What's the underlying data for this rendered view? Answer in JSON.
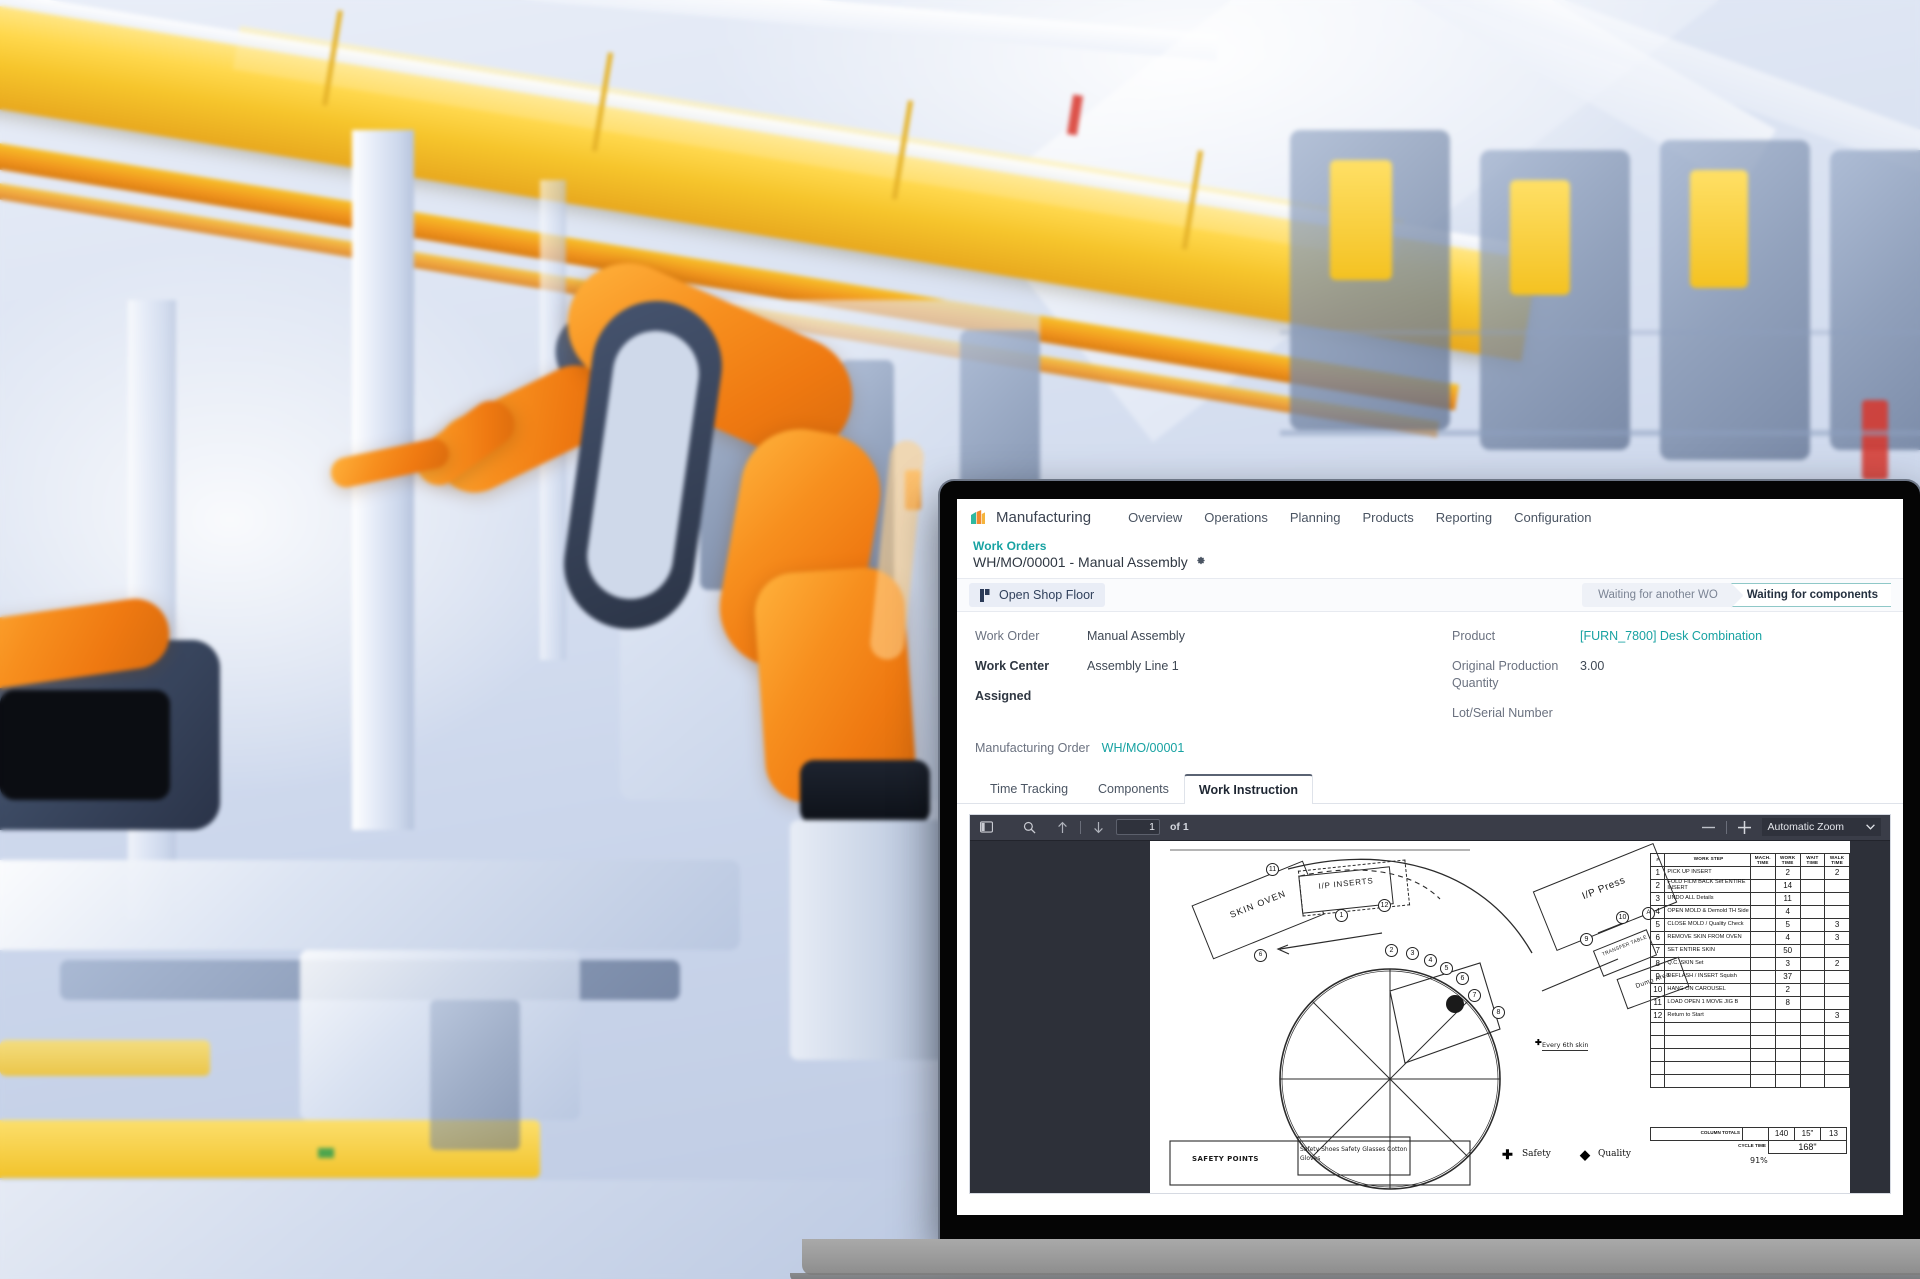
{
  "app": {
    "brand": "Manufacturing",
    "brand_icon": "manufacturing-app-icon",
    "nav": [
      {
        "label": "Overview"
      },
      {
        "label": "Operations"
      },
      {
        "label": "Planning"
      },
      {
        "label": "Products"
      },
      {
        "label": "Reporting"
      },
      {
        "label": "Configuration"
      }
    ]
  },
  "breadcrumb": {
    "parent": "Work Orders",
    "current": "WH/MO/00001 - Manual Assembly",
    "settings_icon": "gear-icon"
  },
  "controls": {
    "open_shop_floor": "Open Shop Floor",
    "shop_floor_icon": "shop-floor-icon",
    "status_steps": [
      {
        "label": "Waiting for another WO",
        "active": false
      },
      {
        "label": "Waiting for components",
        "active": true
      }
    ]
  },
  "form": {
    "left": [
      {
        "label": "Work Order",
        "value": "Manual Assembly",
        "bold": false,
        "link": false
      },
      {
        "label": "Work Center",
        "value": "Assembly Line 1",
        "bold": true,
        "link": false
      },
      {
        "label": "Assigned",
        "value": "",
        "bold": true,
        "link": false
      }
    ],
    "right": [
      {
        "label": "Product",
        "value": "[FURN_7800] Desk Combination",
        "link": true
      },
      {
        "label": "Original Production Quantity",
        "value": "3.00",
        "link": false
      },
      {
        "label": "Lot/Serial Number",
        "value": "",
        "link": false
      }
    ],
    "mo_label": "Manufacturing Order",
    "mo_value": "WH/MO/00001"
  },
  "tabs": [
    {
      "label": "Time Tracking",
      "active": false
    },
    {
      "label": "Components",
      "active": false
    },
    {
      "label": "Work Instruction",
      "active": true
    }
  ],
  "pdf": {
    "toolbar": {
      "sidebar_icon": "sidebar-toggle-icon",
      "search_icon": "search-icon",
      "prev_icon": "arrow-up-icon",
      "next_icon": "arrow-down-icon",
      "page_value": "1",
      "page_total": "of 1",
      "zoom_out_icon": "minus-icon",
      "zoom_in_icon": "plus-icon",
      "zoom_level": "Automatic Zoom",
      "zoom_caret_icon": "chevron-down-icon"
    },
    "page": {
      "stations": [
        {
          "name": "SKIN OVEN"
        },
        {
          "name": "I/P INSERTS"
        },
        {
          "name": "I/P Press"
        },
        {
          "name": "TRANSFER TABLE"
        },
        {
          "name": "Dump Area"
        }
      ],
      "annotation_every_skin": "Every 6th skin",
      "safety_points_label": "SAFETY POINTS",
      "safety_points_value": "Safety Shoes  Safety Glasses  Cotton Gloves",
      "legend": [
        {
          "mark": "✚",
          "text": "Safety"
        },
        {
          "mark": "◆",
          "text": "Quality"
        }
      ],
      "carousel_positions": [
        "1",
        "2",
        "3",
        "4",
        "5",
        "6",
        "7",
        "8",
        "9",
        "10",
        "11",
        "12"
      ],
      "table": {
        "headers": [
          "#",
          "WORK STEP",
          "MACH. TIME",
          "WORK TIME",
          "WAIT TIME",
          "WALK TIME"
        ],
        "rows": [
          {
            "n": "1",
            "step": "PICK UP INSERT",
            "mach": "",
            "work": "2",
            "wait": "",
            "walk": "2"
          },
          {
            "n": "2",
            "step": "FOLD FILM BACK Set ENTIRE INSERT",
            "mach": "",
            "work": "14",
            "wait": "",
            "walk": ""
          },
          {
            "n": "3",
            "step": "UNDO ALL Details",
            "mach": "",
            "work": "11",
            "wait": "",
            "walk": ""
          },
          {
            "n": "4",
            "step": "OPEN MOLD & Demold TH Side",
            "mach": "",
            "work": "4",
            "wait": "",
            "walk": ""
          },
          {
            "n": "5",
            "step": "CLOSE MOLD / Quality Check",
            "mach": "",
            "work": "5",
            "wait": "",
            "walk": "3"
          },
          {
            "n": "6",
            "step": "REMOVE SKIN FROM OVEN",
            "mach": "",
            "work": "4",
            "wait": "",
            "walk": "3"
          },
          {
            "n": "7",
            "step": "SET ENTIRE SKIN",
            "mach": "",
            "work": "50",
            "wait": "",
            "walk": ""
          },
          {
            "n": "8",
            "step": "Q.C. SKIN Set",
            "mach": "",
            "work": "3",
            "wait": "",
            "walk": "2"
          },
          {
            "n": "9",
            "step": "DEFLASH / INSERT Squish",
            "mach": "",
            "work": "37",
            "wait": "",
            "walk": ""
          },
          {
            "n": "10",
            "step": "HANG ON CAROUSEL",
            "mach": "",
            "work": "2",
            "wait": "",
            "walk": ""
          },
          {
            "n": "11",
            "step": "LOAD OPEN 1 MOVE JIG B",
            "mach": "",
            "work": "8",
            "wait": "",
            "walk": ""
          },
          {
            "n": "12",
            "step": "Return to Start",
            "mach": "",
            "work": "",
            "wait": "",
            "walk": "3"
          }
        ],
        "totals_label": "COLUMN TOTALS",
        "totals": {
          "mach": "",
          "work": "140",
          "wait": "15\"",
          "walk": "13"
        },
        "cycle_time_label": "CYCLE TIME",
        "cycle_time": "168\"",
        "cycle_pct": "91%"
      }
    }
  },
  "colors": {
    "accent_teal": "#17a2a2",
    "nav_text": "#4b5563",
    "pdf_chrome": "#3a3d48",
    "robot_orange": "#f78f1e",
    "crane_yellow": "#ffd84d"
  }
}
